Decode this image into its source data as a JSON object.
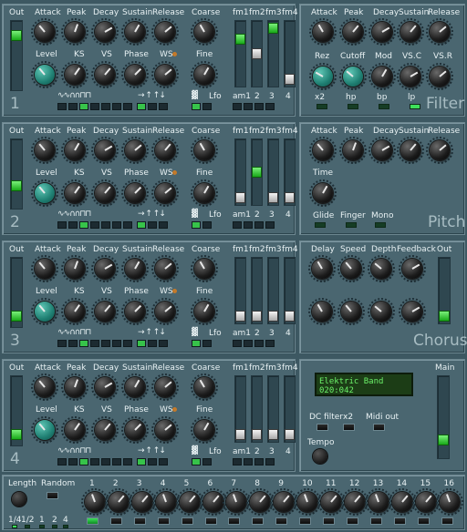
{
  "voices": [
    {
      "number": "1",
      "active_fm": "fm1"
    },
    {
      "number": "2",
      "active_fm": ""
    },
    {
      "number": "3",
      "active_fm": ""
    },
    {
      "number": "4",
      "active_fm": ""
    }
  ],
  "voice_labels": {
    "out": "Out",
    "attack": "Attack",
    "peak": "Peak",
    "decay": "Decay",
    "sustain": "Sustain",
    "release": "Release",
    "coarse": "Coarse",
    "level": "Level",
    "ks": "KS",
    "vs": "VS",
    "phase": "Phase",
    "ws": "WS",
    "fine": "Fine",
    "fm1": "fm1",
    "fm2": "fm2",
    "fm3": "fm3",
    "fm4": "fm4",
    "am1": "am1",
    "s2": "2",
    "s3": "3",
    "s4": "4",
    "lfo": "Lfo",
    "wave_shapes": "∿∿∩∩⊓⊓",
    "arrows": "→ ↑ ↑↓"
  },
  "filter": {
    "title": "Filter",
    "top_labels": [
      "Attack",
      "Peak",
      "Decay",
      "Sustain",
      "Release"
    ],
    "mid_labels": [
      "Rez",
      "Cutoff",
      "Mod",
      "VS.C",
      "VS.R"
    ],
    "buttons": [
      "x2",
      "hp",
      "bp",
      "lp"
    ]
  },
  "pitch": {
    "title": "Pitch",
    "top_labels": [
      "Attack",
      "Peak",
      "Decay",
      "Sustain",
      "Release"
    ],
    "time": "Time",
    "buttons": [
      "Glide",
      "Finger",
      "Mono"
    ]
  },
  "chorus": {
    "title": "Chorus",
    "labels": [
      "Delay",
      "Speed",
      "Depth",
      "Feedback",
      "Out"
    ]
  },
  "master": {
    "lcd_line1": "Elektric Band",
    "lcd_line2": "020:042",
    "main": "Main",
    "dc_filter": "DC filter",
    "x2": "x2",
    "midi_out": "Midi out",
    "tempo": "Tempo"
  },
  "sequencer": {
    "length": "Length",
    "random": "Random",
    "length_opts": [
      "1/4",
      "1/2",
      "1",
      "2",
      "4"
    ],
    "steps": [
      "1",
      "2",
      "3",
      "4",
      "5",
      "6",
      "7",
      "8",
      "9",
      "10",
      "11",
      "12",
      "13",
      "14",
      "15",
      "16"
    ],
    "active_step": "1"
  }
}
